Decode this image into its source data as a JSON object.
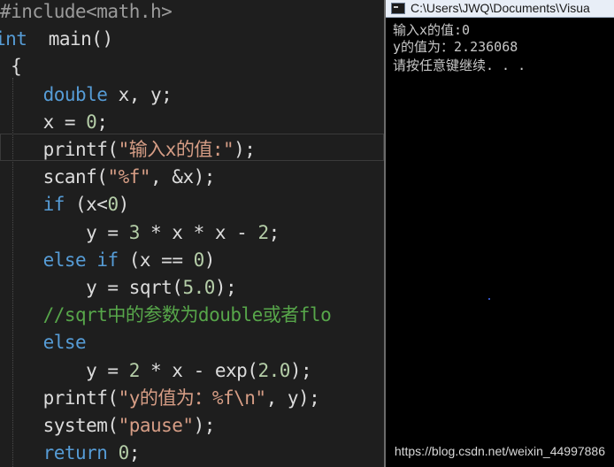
{
  "editor": {
    "lines": [
      {
        "parts": [
          {
            "t": "#include<math.h>",
            "c": "pp"
          }
        ]
      },
      {
        "parts": [
          {
            "t": "int",
            "c": "kw"
          },
          {
            "t": "  main()",
            "c": "fn"
          }
        ]
      },
      {
        "parts": [
          {
            "t": " {",
            "c": "fn"
          }
        ]
      },
      {
        "parts": [
          {
            "t": "    ",
            "c": "fn"
          },
          {
            "t": "double",
            "c": "kw"
          },
          {
            "t": " x, y;",
            "c": "fn"
          }
        ]
      },
      {
        "parts": [
          {
            "t": "    x = ",
            "c": "fn"
          },
          {
            "t": "0",
            "c": "num"
          },
          {
            "t": ";",
            "c": "fn"
          }
        ]
      },
      {
        "parts": [
          {
            "t": "    printf(",
            "c": "fn"
          },
          {
            "t": "\"输入x的值:\"",
            "c": "str"
          },
          {
            "t": ");",
            "c": "fn"
          }
        ]
      },
      {
        "parts": [
          {
            "t": "    scanf(",
            "c": "fn"
          },
          {
            "t": "\"%f\"",
            "c": "str"
          },
          {
            "t": ", &x);",
            "c": "fn"
          }
        ]
      },
      {
        "parts": [
          {
            "t": "    ",
            "c": "fn"
          },
          {
            "t": "if",
            "c": "kw"
          },
          {
            "t": " (x<",
            "c": "fn"
          },
          {
            "t": "0",
            "c": "num"
          },
          {
            "t": ")",
            "c": "fn"
          }
        ]
      },
      {
        "parts": [
          {
            "t": "        y = ",
            "c": "fn"
          },
          {
            "t": "3",
            "c": "num"
          },
          {
            "t": " * x * x - ",
            "c": "fn"
          },
          {
            "t": "2",
            "c": "num"
          },
          {
            "t": ";",
            "c": "fn"
          }
        ]
      },
      {
        "parts": [
          {
            "t": "    ",
            "c": "fn"
          },
          {
            "t": "else",
            "c": "kw"
          },
          {
            "t": " ",
            "c": "fn"
          },
          {
            "t": "if",
            "c": "kw"
          },
          {
            "t": " (x == ",
            "c": "fn"
          },
          {
            "t": "0",
            "c": "num"
          },
          {
            "t": ")",
            "c": "fn"
          }
        ]
      },
      {
        "parts": [
          {
            "t": "        y = sqrt(",
            "c": "fn"
          },
          {
            "t": "5.0",
            "c": "num"
          },
          {
            "t": ");",
            "c": "fn"
          }
        ]
      },
      {
        "parts": [
          {
            "t": "    //sqrt中的参数为double或者flo",
            "c": "cm"
          }
        ]
      },
      {
        "parts": [
          {
            "t": "    ",
            "c": "fn"
          },
          {
            "t": "else",
            "c": "kw"
          }
        ]
      },
      {
        "parts": [
          {
            "t": "        y = ",
            "c": "fn"
          },
          {
            "t": "2",
            "c": "num"
          },
          {
            "t": " * x - exp(",
            "c": "fn"
          },
          {
            "t": "2.0",
            "c": "num"
          },
          {
            "t": ");",
            "c": "fn"
          }
        ]
      },
      {
        "parts": [
          {
            "t": "    printf(",
            "c": "fn"
          },
          {
            "t": "\"y的值为：%f\\n\"",
            "c": "str"
          },
          {
            "t": ", y);",
            "c": "fn"
          }
        ]
      },
      {
        "parts": [
          {
            "t": "    system(",
            "c": "fn"
          },
          {
            "t": "\"pause\"",
            "c": "str"
          },
          {
            "t": ");",
            "c": "fn"
          }
        ]
      },
      {
        "parts": [
          {
            "t": "    ",
            "c": "fn"
          },
          {
            "t": "return",
            "c": "kw"
          },
          {
            "t": " ",
            "c": "fn"
          },
          {
            "t": "0",
            "c": "num"
          },
          {
            "t": ";",
            "c": "fn"
          }
        ]
      }
    ]
  },
  "console": {
    "title": "C:\\Users\\JWQ\\Documents\\Visua",
    "lines": [
      "输入x的值:0",
      "y的值为：2.236068",
      "请按任意键继续. . ."
    ]
  },
  "watermark": "https://blog.csdn.net/weixin_44997886"
}
